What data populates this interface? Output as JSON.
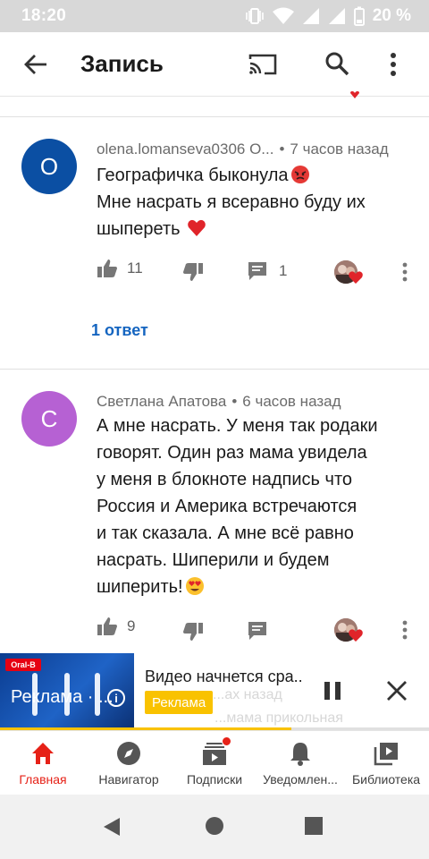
{
  "status_bar": {
    "time": "18:20",
    "battery": "20 %",
    "icons": [
      "vibrate-icon",
      "wifi-icon",
      "signal-icon",
      "signal-icon",
      "battery-icon"
    ]
  },
  "app_bar": {
    "title": "Запись",
    "icons": [
      "back-arrow-icon",
      "cast-icon",
      "search-icon",
      "more-vert-icon"
    ]
  },
  "comments": [
    {
      "avatar_letter": "O",
      "avatar_color": "#0b4fa3",
      "author": "olena.lomanseva0306 O...",
      "time": "7 часов назад",
      "lines": [
        "Географичка быконула",
        "Мне насрать я всеравно буду их",
        "шыпереть"
      ],
      "emojis": [
        "angry-face-emoji",
        "red-heart-emoji"
      ],
      "likes": "11",
      "replies_count": "1",
      "replies_link": "1 ответ"
    },
    {
      "avatar_letter": "C",
      "avatar_color": "#b661d3",
      "author": "Светлана Апатова",
      "time": "6 часов назад",
      "lines": [
        "А мне насрать. У меня так родаки",
        "говорят. Один раз мама увидела",
        "у меня в блокноте надпись что",
        "Россия и Америка встречаются",
        "и так сказала. А мне всё равно",
        "насрать. Шиперили и будем",
        "шиперить!"
      ],
      "emojis": [
        "heart-eyes-emoji"
      ],
      "likes": "9"
    }
  ],
  "mini_player": {
    "thumbnail_brand": "Oral-B",
    "thumbnail_label": "Реклама · ...",
    "title": "Видео начнется сра..",
    "ad_badge": "Реклама",
    "ghost_line_1": "...ах назад",
    "ghost_line_2": "...мама прикольная",
    "progress_fraction": 0.68,
    "accent": "#f9c200"
  },
  "bottom_nav": [
    {
      "label": "Главная",
      "icon": "home-icon",
      "active": true
    },
    {
      "label": "Навигатор",
      "icon": "compass-icon",
      "active": false
    },
    {
      "label": "Подписки",
      "icon": "subscriptions-icon",
      "active": false,
      "badge": true
    },
    {
      "label": "Уведомлен...",
      "icon": "bell-icon",
      "active": false
    },
    {
      "label": "Библиотека",
      "icon": "library-icon",
      "active": false
    }
  ],
  "system_nav": [
    "back-triangle-icon",
    "home-circle-icon",
    "recents-square-icon"
  ],
  "colors": {
    "active_red": "#e62117",
    "link_blue": "#1565c0",
    "text_secondary": "#6b6b6b"
  }
}
